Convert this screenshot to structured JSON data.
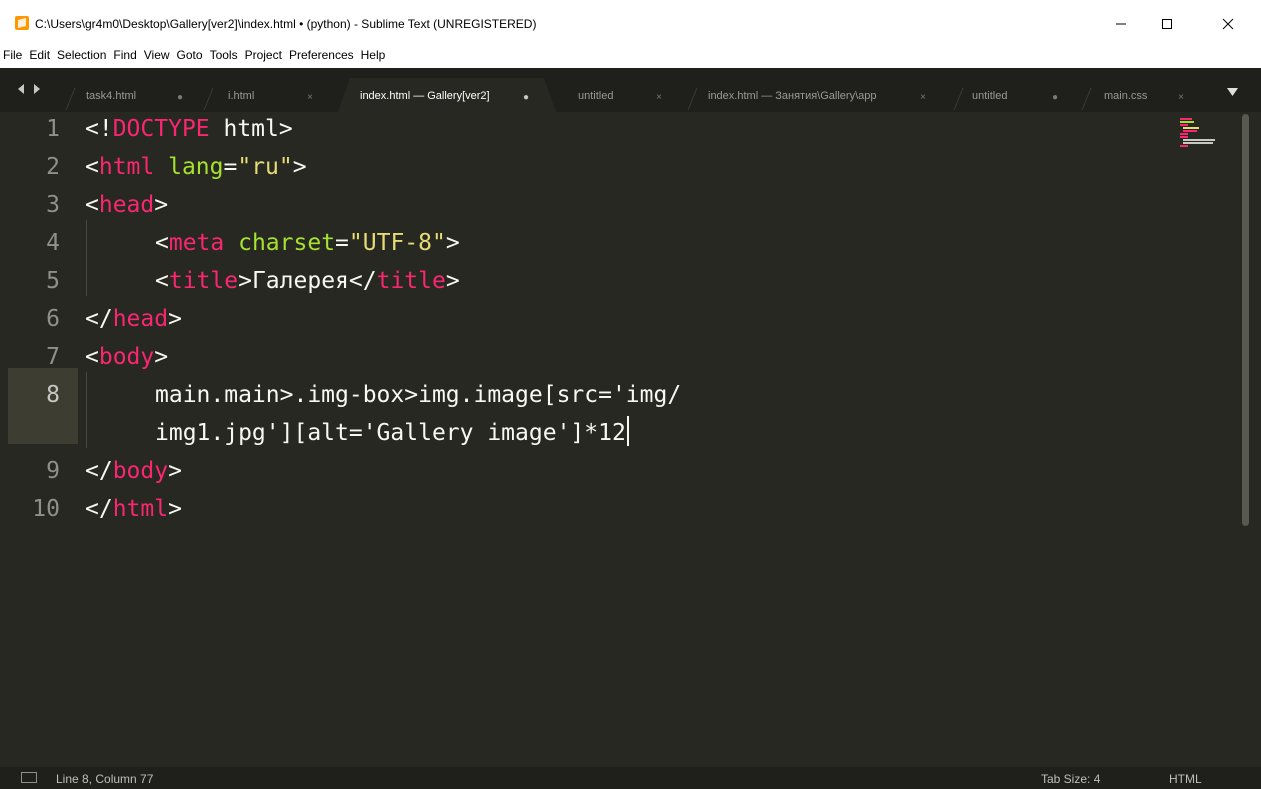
{
  "window": {
    "title": "C:\\Users\\gr4m0\\Desktop\\Gallery[ver2]\\index.html • (python) - Sublime Text (UNREGISTERED)",
    "controls": {
      "minimize": "minimize",
      "maximize": "maximize",
      "close": "close"
    }
  },
  "menu": [
    "File",
    "Edit",
    "Selection",
    "Find",
    "View",
    "Goto",
    "Tools",
    "Project",
    "Preferences",
    "Help"
  ],
  "tabs": [
    {
      "label": "task4.html",
      "state": "modified",
      "indicator": "●"
    },
    {
      "label": "i.html",
      "state": "saved",
      "indicator": "×"
    },
    {
      "label": "index.html — Gallery[ver2]",
      "state": "modified",
      "indicator": "●",
      "active": true
    },
    {
      "label": "untitled",
      "state": "saved",
      "indicator": "×"
    },
    {
      "label": "index.html — Занятия\\Gallery\\app",
      "state": "saved",
      "indicator": "×"
    },
    {
      "label": "untitled",
      "state": "modified",
      "indicator": "●"
    },
    {
      "label": "main.css",
      "state": "saved",
      "indicator": "×"
    }
  ],
  "editor": {
    "line_numbers": [
      "1",
      "2",
      "3",
      "4",
      "5",
      "6",
      "7",
      "8",
      "9",
      "10"
    ],
    "current_line": "8",
    "lines": [
      [
        "<!",
        "DOCTYPE",
        " html>"
      ],
      [
        "<",
        "html",
        " ",
        "lang",
        "=",
        "\"ru\"",
        ">"
      ],
      [
        "<",
        "head",
        ">"
      ],
      [
        "<",
        "meta",
        " ",
        "charset",
        "=",
        "\"UTF-8\"",
        ">"
      ],
      [
        "<",
        "title",
        ">Галерея</",
        "title",
        ">"
      ],
      [
        "</",
        "head",
        ">"
      ],
      [
        "<",
        "body",
        ">"
      ],
      [
        "main.main>.img-box>img.image[src='img/"
      ],
      [
        "img1.jpg'][alt='Gallery image']*12"
      ],
      [
        "</",
        "body",
        ">"
      ],
      [
        "</",
        "html",
        ">"
      ]
    ]
  },
  "status": {
    "position": "Line 8, Column 77",
    "tab_size": "Tab Size: 4",
    "syntax": "HTML"
  },
  "colors": {
    "editor_bg": "#272822",
    "tag": "#f92672",
    "attribute": "#a6e22e",
    "string": "#e6db74",
    "text": "#f8f8f2",
    "brand": "#ff9800"
  }
}
